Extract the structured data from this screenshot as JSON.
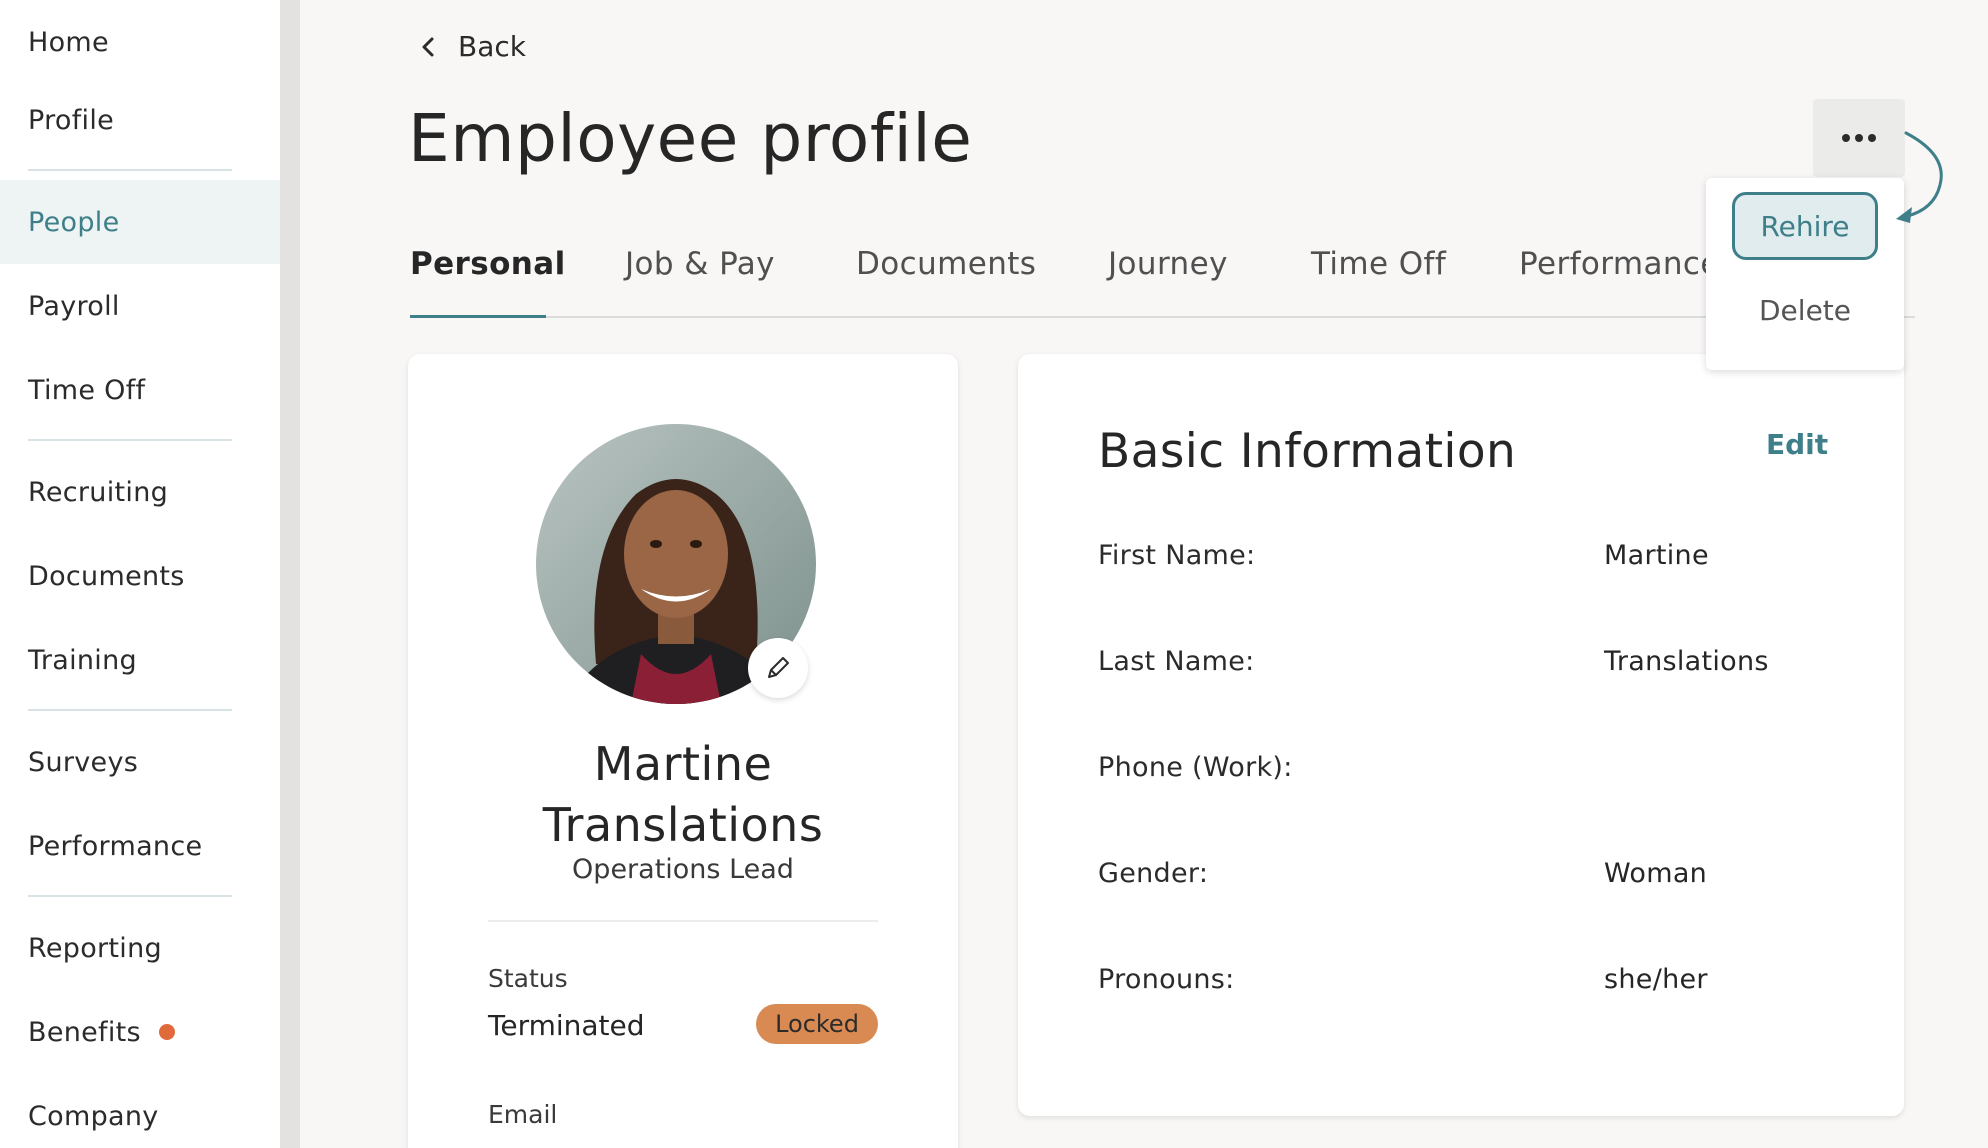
{
  "sidebar": {
    "items": [
      {
        "label": "Home",
        "active": false
      },
      {
        "label": "Profile",
        "active": false
      },
      {
        "label": "People",
        "active": true
      },
      {
        "label": "Payroll",
        "active": false
      },
      {
        "label": "Time Off",
        "active": false
      },
      {
        "label": "Recruiting",
        "active": false
      },
      {
        "label": "Documents",
        "active": false
      },
      {
        "label": "Training",
        "active": false
      },
      {
        "label": "Surveys",
        "active": false
      },
      {
        "label": "Performance",
        "active": false
      },
      {
        "label": "Reporting",
        "active": false
      },
      {
        "label": "Benefits",
        "active": false,
        "notification": true
      },
      {
        "label": "Company",
        "active": false
      }
    ]
  },
  "header": {
    "back_label": "Back",
    "title": "Employee profile"
  },
  "tabs": [
    {
      "label": "Personal",
      "active": true
    },
    {
      "label": "Job & Pay",
      "active": false
    },
    {
      "label": "Documents",
      "active": false
    },
    {
      "label": "Journey",
      "active": false
    },
    {
      "label": "Time Off",
      "active": false
    },
    {
      "label": "Performance",
      "active": false
    }
  ],
  "menu": {
    "rehire_label": "Rehire",
    "delete_label": "Delete"
  },
  "employee": {
    "first_name": "Martine",
    "last_name": "Translations",
    "role": "Operations Lead",
    "status_label": "Status",
    "status_value": "Terminated",
    "status_badge": "Locked",
    "email_label": "Email"
  },
  "basic_info": {
    "title": "Basic Information",
    "edit_label": "Edit",
    "fields": [
      {
        "label": "First Name:",
        "value": "Martine"
      },
      {
        "label": "Last Name:",
        "value": "Translations"
      },
      {
        "label": "Phone (Work):",
        "value": ""
      },
      {
        "label": "Gender:",
        "value": "Woman"
      },
      {
        "label": "Pronouns:",
        "value": "she/her"
      }
    ]
  },
  "colors": {
    "accent": "#3e7f89",
    "badge": "#d98a52",
    "notification": "#e06a3b"
  },
  "icons": [
    "chevron-left-icon",
    "more-horizontal-icon",
    "pencil-icon",
    "curved-arrow-icon"
  ]
}
